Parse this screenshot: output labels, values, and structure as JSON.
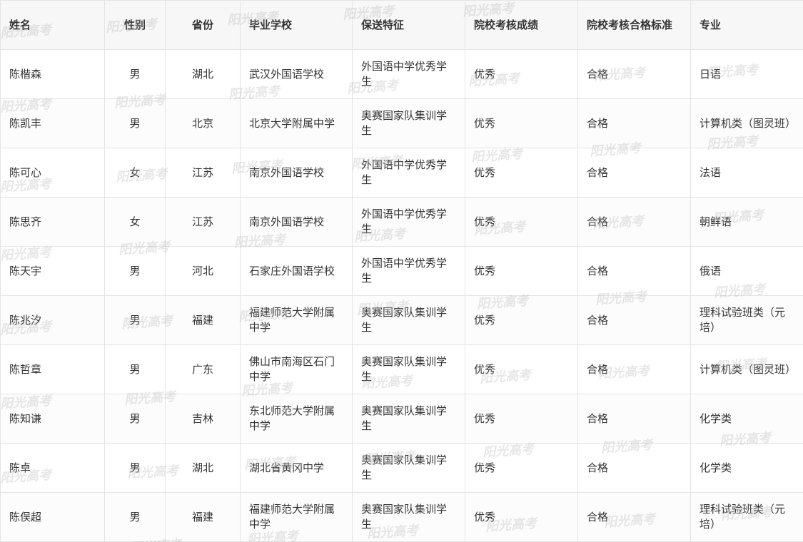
{
  "table": {
    "headers": [
      "姓名",
      "性别",
      "省份",
      "毕业学校",
      "保送特征",
      "院校考核成绩",
      "院校考核合格标准",
      "专业"
    ],
    "rows": [
      [
        "陈楷森",
        "男",
        "湖北",
        "武汉外国语学校",
        "外国语中学优秀学生",
        "优秀",
        "合格",
        "日语"
      ],
      [
        "陈凯丰",
        "男",
        "北京",
        "北京大学附属中学",
        "奥赛国家队集训学生",
        "优秀",
        "合格",
        "计算机类（图灵班）"
      ],
      [
        "陈可心",
        "女",
        "江苏",
        "南京外国语学校",
        "外国语中学优秀学生",
        "优秀",
        "合格",
        "法语"
      ],
      [
        "陈思齐",
        "女",
        "江苏",
        "南京外国语学校",
        "外国语中学优秀学生",
        "优秀",
        "合格",
        "朝鲜语"
      ],
      [
        "陈天宇",
        "男",
        "河北",
        "石家庄外国语学校",
        "外国语中学优秀学生",
        "优秀",
        "合格",
        "俄语"
      ],
      [
        "陈兆汐",
        "男",
        "福建",
        "福建师范大学附属中学",
        "奥赛国家队集训学生",
        "优秀",
        "合格",
        "理科试验班类（元培）"
      ],
      [
        "陈哲章",
        "男",
        "广东",
        "佛山市南海区石门中学",
        "奥赛国家队集训学生",
        "优秀",
        "合格",
        "计算机类（图灵班）"
      ],
      [
        "陈知谦",
        "男",
        "吉林",
        "东北师范大学附属中学",
        "奥赛国家队集训学生",
        "优秀",
        "合格",
        "化学类"
      ],
      [
        "陈卓",
        "男",
        "湖北",
        "湖北省黄冈中学",
        "奥赛国家队集训学生",
        "优秀",
        "合格",
        "化学类"
      ],
      [
        "陈俣超",
        "男",
        "福建",
        "福建师范大学附属中学",
        "奥赛国家队集训学生",
        "优秀",
        "合格",
        "理科试验班类（元培）"
      ]
    ]
  },
  "watermark": {
    "text": "阳光高考"
  }
}
